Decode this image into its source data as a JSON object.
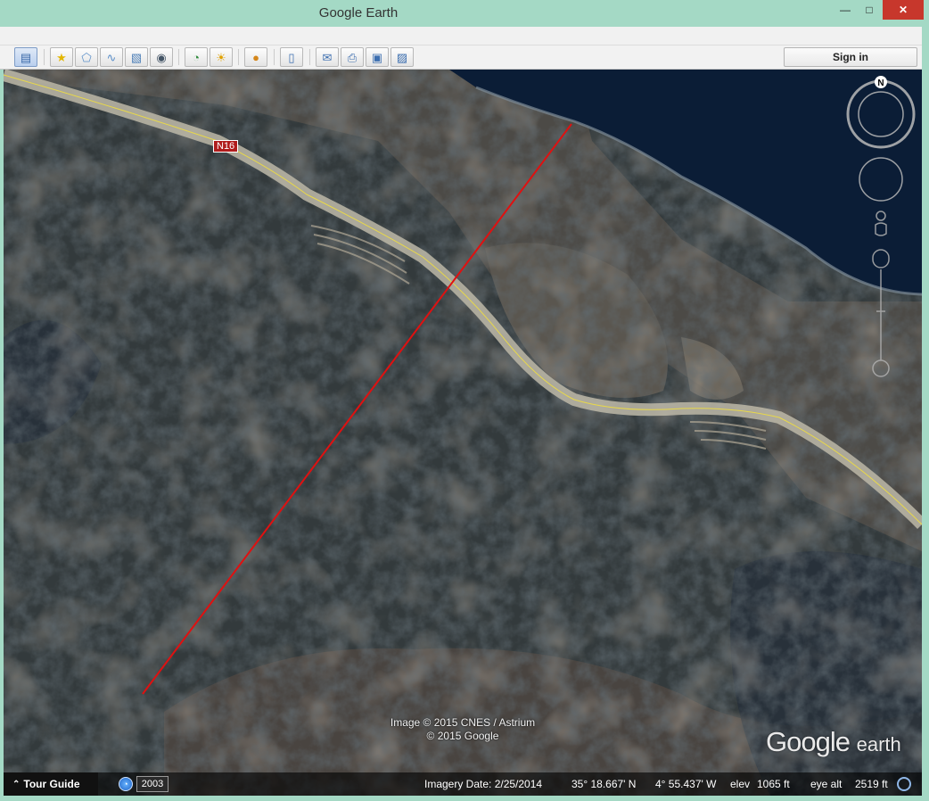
{
  "window": {
    "title": "Google Earth",
    "minimize": "—",
    "maximize": "□",
    "close": "✕"
  },
  "toolbar": {
    "buttons": [
      {
        "name": "sidebar-toggle-button",
        "icon": "sidebar-icon",
        "glyph": "▤"
      },
      {
        "name": "add-placemark-button",
        "icon": "placemark-icon",
        "glyph": "★"
      },
      {
        "name": "add-polygon-button",
        "icon": "polygon-icon",
        "glyph": "⬠"
      },
      {
        "name": "add-path-button",
        "icon": "path-icon",
        "glyph": "∿"
      },
      {
        "name": "add-image-overlay-button",
        "icon": "image-overlay-icon",
        "glyph": "▧"
      },
      {
        "name": "record-tour-button",
        "icon": "record-tour-icon",
        "glyph": "◉"
      },
      {
        "name": "historical-imagery-button",
        "icon": "historical-imagery-icon",
        "glyph": "◔"
      },
      {
        "name": "sunlight-button",
        "icon": "sunlight-icon",
        "glyph": "☀"
      },
      {
        "name": "planets-button",
        "icon": "planet-icon",
        "glyph": "●"
      },
      {
        "name": "ruler-button",
        "icon": "ruler-icon",
        "glyph": "▯"
      },
      {
        "name": "email-button",
        "icon": "email-icon",
        "glyph": "✉"
      },
      {
        "name": "print-button",
        "icon": "print-icon",
        "glyph": "⎙"
      },
      {
        "name": "save-image-button",
        "icon": "save-image-icon",
        "glyph": "▣"
      },
      {
        "name": "view-in-maps-button",
        "icon": "maps-icon",
        "glyph": "▨"
      }
    ],
    "sign_in": "Sign in"
  },
  "map": {
    "road_label": "N16",
    "compass_north": "N",
    "copyright_line1": "Image © 2015 CNES / Astrium",
    "copyright_line2": "© 2015 Google",
    "logo_google": "Google",
    "logo_earth": "earth",
    "measure_line_color": "#e01010",
    "water_color": "#0b1d36",
    "road_color": "#d6d0bb",
    "road_centerline_color": "#e8d84a"
  },
  "status": {
    "tour_guide": "Tour Guide",
    "history_year": "2003",
    "imagery_date": "Imagery Date: 2/25/2014",
    "latitude": "35° 18.667' N",
    "longitude": "4° 55.437' W",
    "elev_label": "elev",
    "elev_value": "1065 ft",
    "eye_alt_label": "eye alt",
    "eye_alt_value": "2519 ft"
  }
}
